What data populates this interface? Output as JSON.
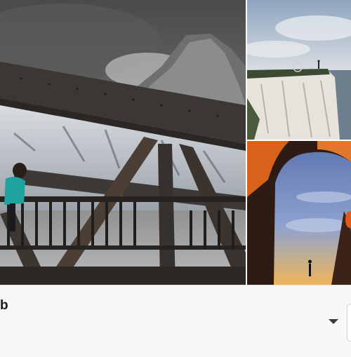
{
  "gallery": {
    "photos": [
      {
        "subject": "person-on-steel-truss-bridge-with-snowy-mountain"
      },
      {
        "subject": "person-standing-on-white-sea-cliff"
      },
      {
        "subject": "silhouette-under-glowing-rock-arch"
      }
    ]
  },
  "footer": {
    "label": "b",
    "dropdown_icon": "caret-down-icon"
  },
  "colors": {
    "bar_background": "#f7f7f7",
    "label_text": "#1b1b1b",
    "caret": "#3a3a3a"
  }
}
